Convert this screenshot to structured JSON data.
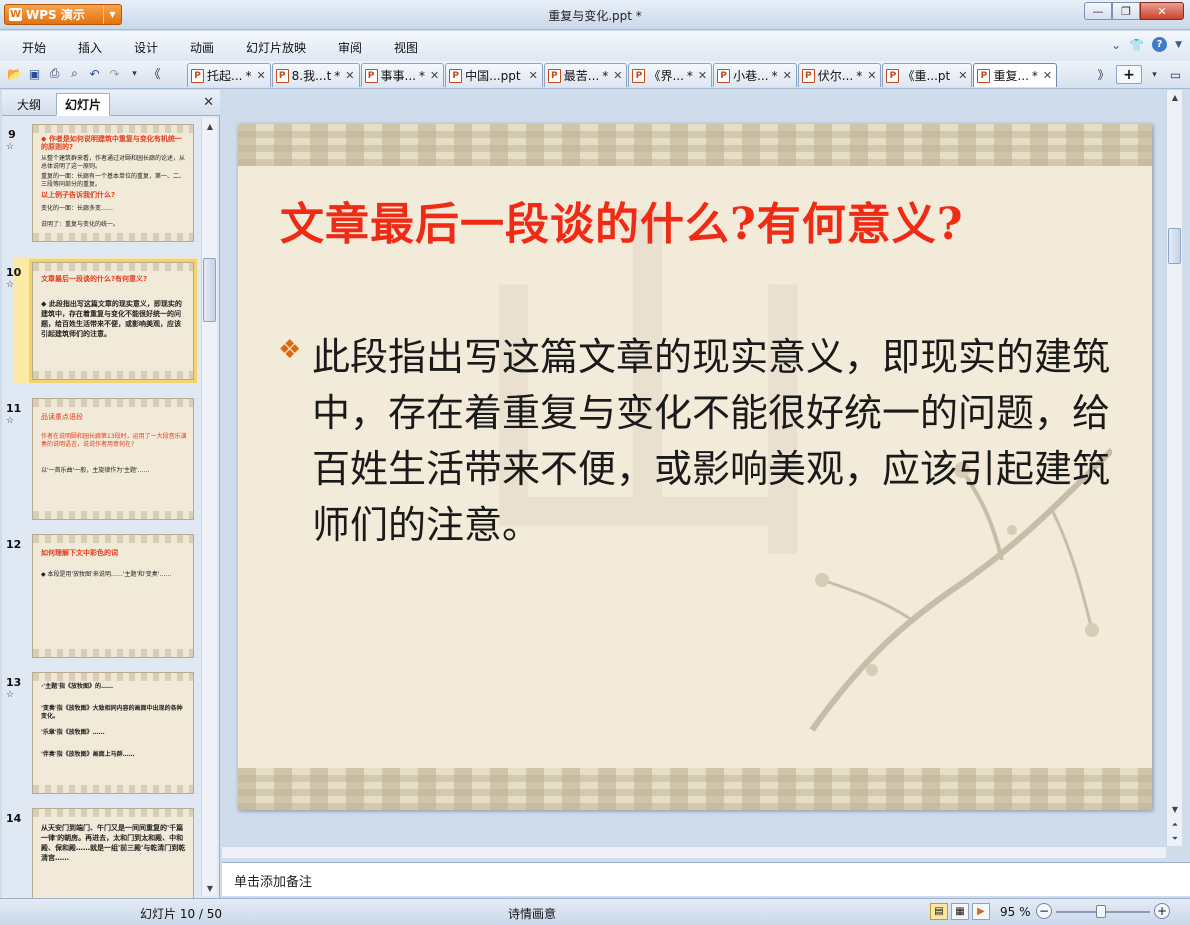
{
  "app": {
    "logo_label": "WPS 演示",
    "window_title": "重复与变化.ppt *"
  },
  "menu": [
    "开始",
    "插入",
    "设计",
    "动画",
    "幻灯片放映",
    "审阅",
    "视图"
  ],
  "doc_tabs": [
    {
      "label": "托起...",
      "mod": " *"
    },
    {
      "label": "8.我...t",
      "mod": " *"
    },
    {
      "label": "事事...",
      "mod": " *"
    },
    {
      "label": "中国...ppt",
      "mod": ""
    },
    {
      "label": "最苦...",
      "mod": " *"
    },
    {
      "label": "《界...",
      "mod": " *"
    },
    {
      "label": "小巷...",
      "mod": " *"
    },
    {
      "label": "伏尔...",
      "mod": " *"
    },
    {
      "label": "《重...pt",
      "mod": ""
    },
    {
      "label": "重复...",
      "mod": " *"
    }
  ],
  "left_pane": {
    "tab_outline": "大纲",
    "tab_slides": "幻灯片",
    "thumbnails": [
      {
        "num": "9",
        "star": "☆",
        "lines": [
          "◆ 作者是如何说明建筑中重复与变化有机统一的原则的?",
          "从整个建筑群来看，作者通过对颐和园长廊的论述，从总体说明了这一原则。",
          "重复的一面：长廊有一个基本单位的重复，第一、二、三段等同部分的重复。",
          "以上例子告诉我们什么?",
          "变化的一面：长廊多变……",
          "说明了：重复与变化的统一。"
        ]
      },
      {
        "num": "10",
        "star": "☆",
        "lines": [
          "文章最后一段谈的什么?有何意义?",
          "◆ 此段指出写这篇文章的现实意义，即现实的建筑中，存在着重复与变化不能很好统一的问题，给百姓生活带来不便，或影响美观，应该引起建筑师们的注意。"
        ]
      },
      {
        "num": "11",
        "star": "☆",
        "lines": [
          "品读重点语段",
          "作者在说明颐和园长廊第13段时，运用了一大段音乐演奏的说明语言，说说作者用意何在?",
          "以'一首乐曲'一般，主旋律作为'主题'……"
        ]
      },
      {
        "num": "12",
        "star": "",
        "lines": [
          "如何理解下文中彩色的词",
          "◆ 本段是用'放牧图'来说明……'主题'和'变奏'……"
        ]
      },
      {
        "num": "13",
        "star": "☆",
        "lines": [
          "·'主题'指《放牧图》的……",
          "'变奏'指《放牧图》大致相同内容的画面中出现的各种变化。",
          "'乐章'指《放牧图》……",
          "'伴奏'指《放牧图》画面上马群……"
        ]
      },
      {
        "num": "14",
        "star": "",
        "lines": [
          "从天安门到端门、午门又是一间间重复的'千篇一律'的朝房。再进去，太和门到太和殿、中和殿、保和殿……就是一组'前三殿'与乾清门到乾清宫……"
        ]
      }
    ]
  },
  "slide": {
    "title": "文章最后一段谈的什么?有何意义?",
    "bullet": "此段指出写这篇文章的现实意义，即现实的建筑中，存在着重复与变化不能很好统一的问题，给百姓生活带来不便，或影响美观，应该引起建筑师们的注意。"
  },
  "notes_placeholder": "单击添加备注",
  "status": {
    "slide_pos": "幻灯片 10 / 50",
    "theme": "诗情画意",
    "zoom": "95 %"
  }
}
